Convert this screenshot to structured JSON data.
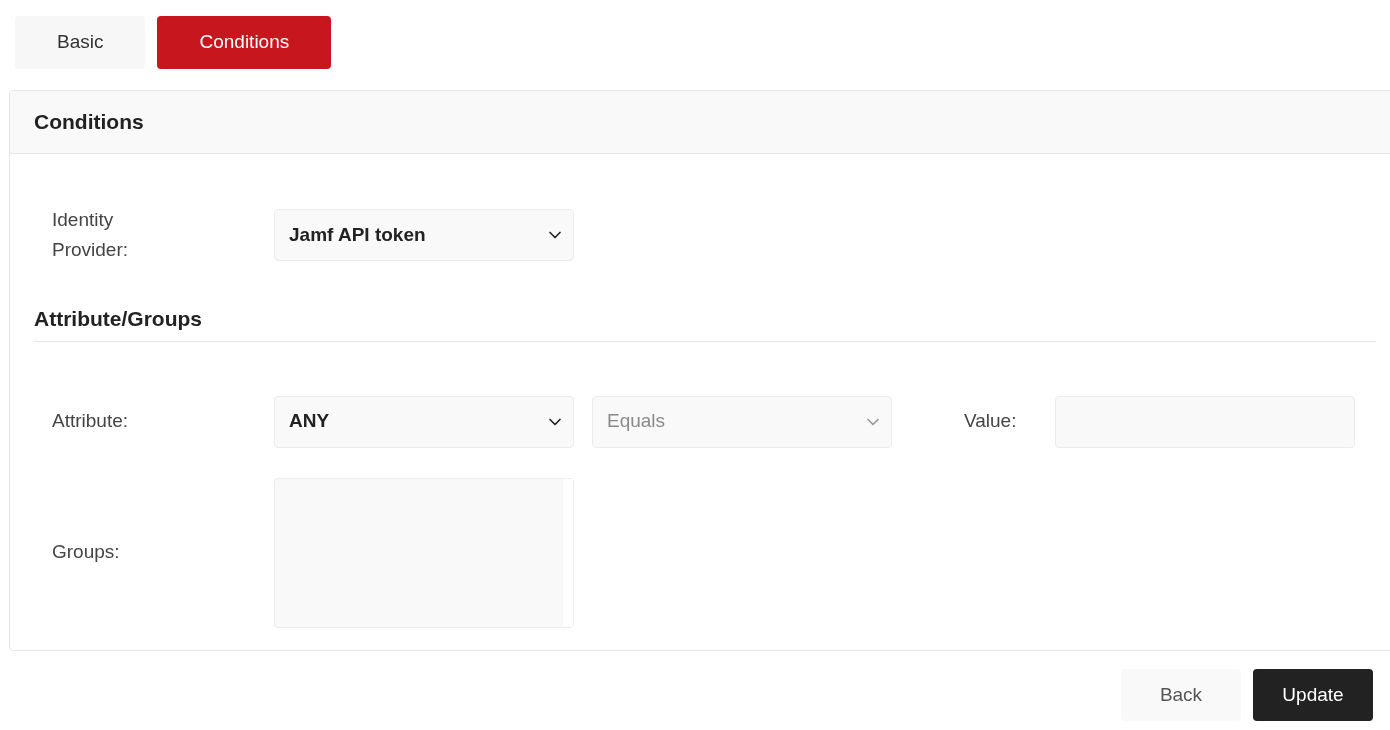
{
  "tabs": [
    {
      "label": "Basic",
      "selected": false
    },
    {
      "label": "Conditions",
      "selected": true
    }
  ],
  "panel": {
    "title": "Conditions",
    "identity_provider": {
      "label": "Identity Provider:",
      "value": "Jamf API token"
    },
    "section_title": "Attribute/Groups",
    "attribute": {
      "label": "Attribute:",
      "value": "ANY",
      "operator": {
        "value": "Equals",
        "disabled": true
      },
      "value_label": "Value:"
    },
    "groups": {
      "label": "Groups:"
    }
  },
  "buttons": [
    {
      "label": "Back",
      "kind": "secondary"
    },
    {
      "label": "Update",
      "kind": "primary"
    }
  ]
}
